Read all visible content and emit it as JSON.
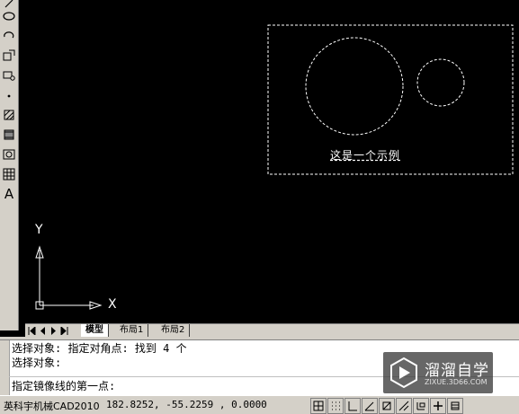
{
  "toolbar": {
    "tools": [
      {
        "icon": "ellipse-icon"
      },
      {
        "icon": "ellipse-arc-icon"
      },
      {
        "icon": "insert-block-icon"
      },
      {
        "icon": "make-block-icon"
      },
      {
        "icon": "point-icon"
      },
      {
        "icon": "hatch-icon"
      },
      {
        "icon": "gradient-icon"
      },
      {
        "icon": "region-icon"
      },
      {
        "icon": "table-icon"
      },
      {
        "icon": "multiline-text-icon"
      }
    ],
    "text_tool_glyph": "A"
  },
  "canvas": {
    "selected_text": "这是一个示例",
    "ucs_y_label": "Y",
    "ucs_x_label": "X",
    "background_color": "#000000",
    "selection_color": "#ffffff"
  },
  "layout_tabs": {
    "tabs": [
      "模型",
      "布局1",
      "布局2"
    ],
    "active": "模型"
  },
  "command": {
    "history": [
      "选择对象: 指定对角点: 找到 4 个",
      "选择对象:"
    ],
    "prompt": "指定镜像线的第一点:"
  },
  "status": {
    "app_name": "英科宇机械CAD2010",
    "coordinates": "182.8252, -55.2259 , 0.0000",
    "buttons": [
      "snap-icon",
      "grid-icon",
      "ortho-icon",
      "polar-icon",
      "osnap-icon",
      "otrack-icon",
      "ducs-icon",
      "dyn-icon",
      "lineweight-icon"
    ]
  },
  "watermark": {
    "title": "溜溜自学",
    "url": "ZIXUE.3D66.COM"
  }
}
